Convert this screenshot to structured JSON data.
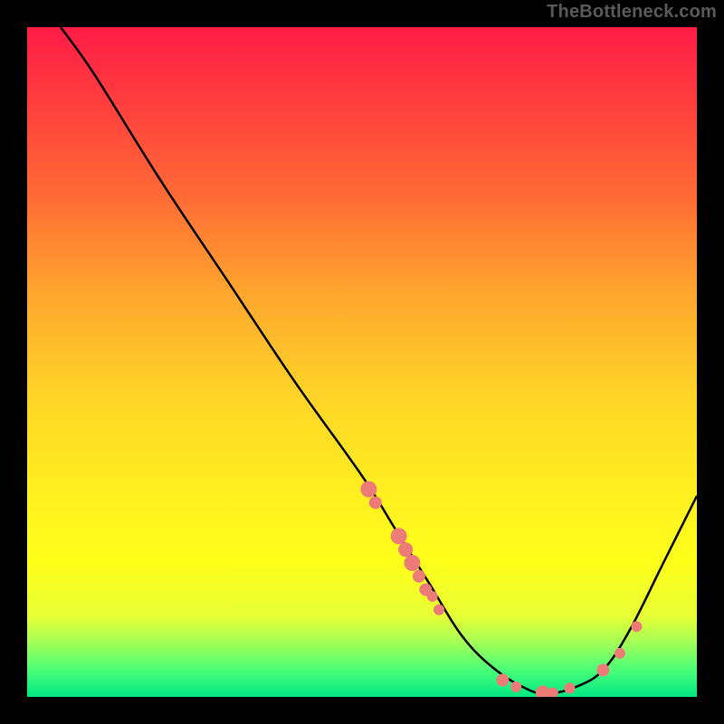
{
  "watermark": "TheBottleneck.com",
  "chart_data": {
    "type": "line",
    "title": "",
    "xlabel": "",
    "ylabel": "",
    "xlim": [
      0,
      100
    ],
    "ylim": [
      0,
      100
    ],
    "grid": false,
    "legend": "none",
    "curve": [
      {
        "x": 5,
        "y": 100
      },
      {
        "x": 10,
        "y": 93
      },
      {
        "x": 20,
        "y": 77
      },
      {
        "x": 30,
        "y": 62
      },
      {
        "x": 40,
        "y": 47
      },
      {
        "x": 50,
        "y": 33
      },
      {
        "x": 55,
        "y": 25
      },
      {
        "x": 60,
        "y": 17
      },
      {
        "x": 65,
        "y": 9
      },
      {
        "x": 70,
        "y": 4
      },
      {
        "x": 75,
        "y": 1
      },
      {
        "x": 78,
        "y": 0.5
      },
      {
        "x": 82,
        "y": 1.5
      },
      {
        "x": 86,
        "y": 4
      },
      {
        "x": 90,
        "y": 10
      },
      {
        "x": 95,
        "y": 20
      },
      {
        "x": 100,
        "y": 30
      }
    ],
    "markers": [
      {
        "x": 51,
        "y": 31,
        "r": 9
      },
      {
        "x": 52,
        "y": 29,
        "r": 7
      },
      {
        "x": 55.5,
        "y": 24,
        "r": 9
      },
      {
        "x": 56.5,
        "y": 22,
        "r": 8
      },
      {
        "x": 57.5,
        "y": 20,
        "r": 9
      },
      {
        "x": 58.5,
        "y": 18,
        "r": 7
      },
      {
        "x": 59.5,
        "y": 16,
        "r": 7
      },
      {
        "x": 60.5,
        "y": 15,
        "r": 6
      },
      {
        "x": 61.5,
        "y": 13,
        "r": 6
      },
      {
        "x": 71,
        "y": 2.5,
        "r": 7
      },
      {
        "x": 73,
        "y": 1.5,
        "r": 6
      },
      {
        "x": 77,
        "y": 0.6,
        "r": 8
      },
      {
        "x": 78.5,
        "y": 0.6,
        "r": 6
      },
      {
        "x": 81,
        "y": 1.3,
        "r": 6
      },
      {
        "x": 86,
        "y": 4,
        "r": 7
      },
      {
        "x": 88.5,
        "y": 6.5,
        "r": 6
      },
      {
        "x": 91,
        "y": 10.5,
        "r": 6
      }
    ],
    "colors": {
      "curve_stroke": "#000000",
      "marker_fill": "#ed7b78"
    }
  }
}
